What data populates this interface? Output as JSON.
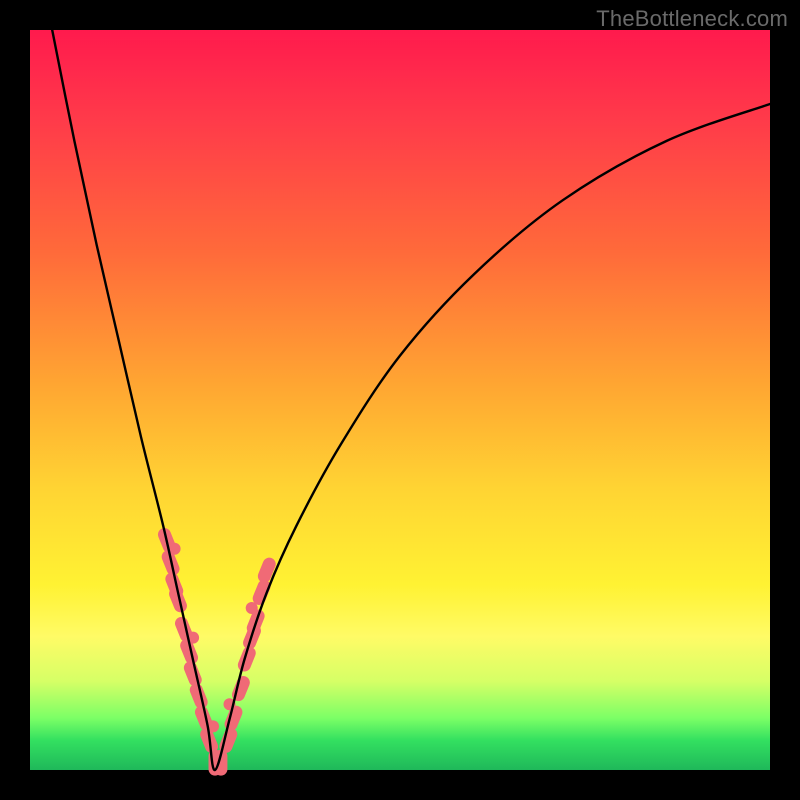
{
  "watermark": "TheBottleneck.com",
  "colors": {
    "frame": "#000000",
    "curve": "#000000",
    "markers": "#f06a76",
    "gradient_top": "#ff1a4d",
    "gradient_bottom": "#1fb85a"
  },
  "chart_data": {
    "type": "line",
    "title": "",
    "xlabel": "",
    "ylabel": "",
    "xlim": [
      0,
      100
    ],
    "ylim": [
      0,
      100
    ],
    "notes": "V-shaped bottleneck curve; y≈0 is optimal (green), y≈100 is worst (red). Minimum near x≈25. Pink markers cluster on both walls of the V near the bottom.",
    "series": [
      {
        "name": "bottleneck-curve",
        "x": [
          3,
          6,
          9,
          12,
          15,
          18,
          20,
          22,
          24,
          25,
          27,
          29,
          32,
          36,
          42,
          50,
          60,
          72,
          86,
          100
        ],
        "y": [
          100,
          85,
          71,
          58,
          45,
          33,
          24,
          15,
          6,
          0,
          7,
          15,
          24,
          33,
          44,
          56,
          67,
          77,
          85,
          90
        ]
      }
    ],
    "markers": {
      "name": "sample-points",
      "points": [
        {
          "x": 18.5,
          "y": 31
        },
        {
          "x": 19.0,
          "y": 28
        },
        {
          "x": 19.5,
          "y": 25
        },
        {
          "x": 20.0,
          "y": 23
        },
        {
          "x": 20.8,
          "y": 19
        },
        {
          "x": 21.5,
          "y": 16
        },
        {
          "x": 22.0,
          "y": 13
        },
        {
          "x": 22.8,
          "y": 10
        },
        {
          "x": 23.5,
          "y": 7
        },
        {
          "x": 24.2,
          "y": 4
        },
        {
          "x": 25.0,
          "y": 1
        },
        {
          "x": 25.8,
          "y": 1
        },
        {
          "x": 26.8,
          "y": 4
        },
        {
          "x": 27.5,
          "y": 7
        },
        {
          "x": 28.5,
          "y": 11
        },
        {
          "x": 29.3,
          "y": 15
        },
        {
          "x": 30.0,
          "y": 18
        },
        {
          "x": 30.5,
          "y": 20
        },
        {
          "x": 31.3,
          "y": 24
        },
        {
          "x": 32.0,
          "y": 27
        }
      ]
    }
  }
}
